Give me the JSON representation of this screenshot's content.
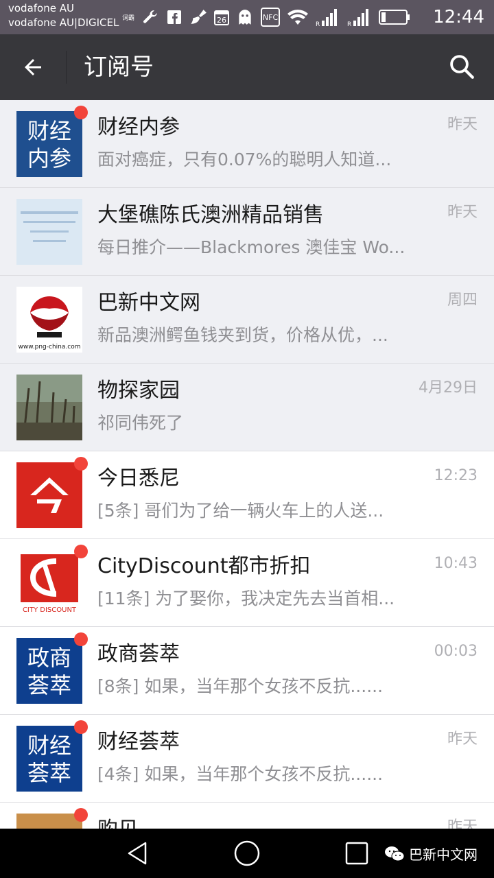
{
  "status_bar": {
    "carrier_1": "vodafone AU",
    "carrier_2": "vodafone AU|DIGICEL",
    "small_label": "词霸",
    "nfc_label": "NFC",
    "time": "12:44",
    "icons": [
      "wrench-icon",
      "facebook-icon",
      "broom-icon",
      "calendar-icon",
      "ghost-icon",
      "nfc-icon",
      "wifi-icon",
      "signal-icon",
      "signal-icon",
      "battery-icon"
    ]
  },
  "app_bar": {
    "title": "订阅号",
    "back_icon": "arrow-left-icon",
    "search_icon": "search-icon"
  },
  "accounts": [
    {
      "name": "财经内参",
      "preview": "面对癌症，只有0.07%的聪明人知道...",
      "time": "昨天",
      "unread": true,
      "pinned": true,
      "avatar_text": [
        "财经",
        "内参"
      ],
      "avatar_color": "#1f4f8f"
    },
    {
      "name": "大堡礁陈氏澳洲精品销售",
      "preview": "每日推介——Blackmores 澳佳宝 Wo...",
      "time": "昨天",
      "unread": false,
      "pinned": true
    },
    {
      "name": "巴新中文网",
      "preview": "新品澳洲鳄鱼钱夹到货，价格从优，...",
      "time": "周四",
      "unread": false,
      "pinned": true,
      "avatar_caption": "www.png-china.com"
    },
    {
      "name": "物探家园",
      "preview": "祁同伟死了",
      "time": "4月29日",
      "unread": false,
      "pinned": true
    },
    {
      "name": "今日悉尼",
      "preview": "[5条] 哥们为了给一辆火车上的人送...",
      "time": "12:23",
      "unread": true,
      "pinned": false,
      "avatar_color": "#d8261e"
    },
    {
      "name": "CityDiscount都市折扣",
      "preview": "[11条] 为了娶你，我决定先去当首相...",
      "time": "10:43",
      "unread": true,
      "pinned": false,
      "avatar_caption": "CITY DISCOUNT",
      "avatar_color": "#d8261e"
    },
    {
      "name": "政商荟萃",
      "preview": "[8条] 如果，当年那个女孩不反抗......",
      "time": "00:03",
      "unread": true,
      "pinned": false,
      "avatar_text": [
        "政商",
        "荟萃"
      ],
      "avatar_color": "#0e3f8e"
    },
    {
      "name": "财经荟萃",
      "preview": "[4条] 如果，当年那个女孩不反抗......",
      "time": "昨天",
      "unread": true,
      "pinned": false,
      "avatar_text": [
        "财经",
        "荟萃"
      ],
      "avatar_color": "#0e3f8e"
    },
    {
      "name": "购见",
      "preview": "",
      "time": "昨天",
      "unread": true,
      "pinned": false
    }
  ],
  "nav_bar": {
    "icons": [
      "nav-back-icon",
      "nav-home-icon",
      "nav-recents-icon"
    ],
    "watermark": "巴新中文网",
    "watermark_icon": "wechat-icon"
  },
  "colors": {
    "status_bar": "#5b5560",
    "app_bar": "#37373b",
    "unread_dot": "#f2443a",
    "pinned_row": "#eff0f4"
  }
}
